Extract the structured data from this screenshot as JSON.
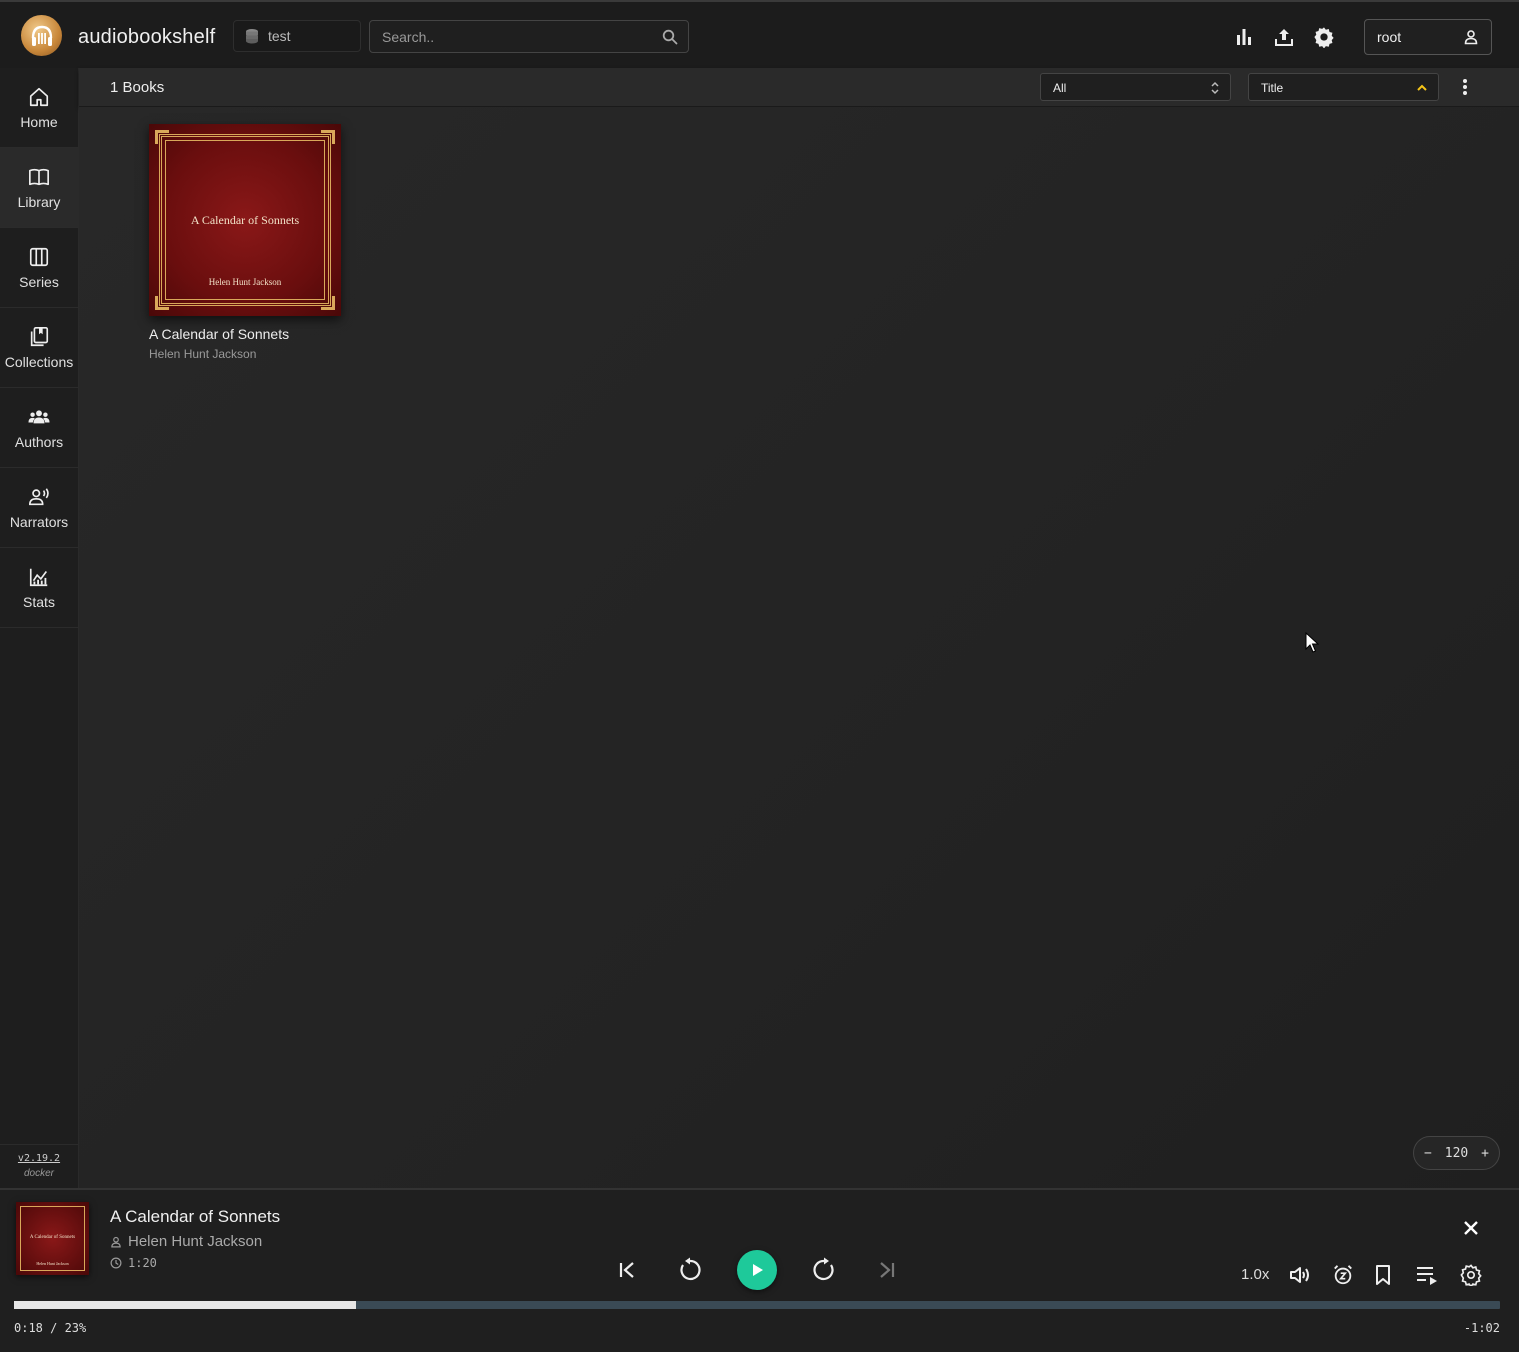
{
  "header": {
    "app_title": "audiobookshelf",
    "library_name": "test",
    "search_placeholder": "Search..",
    "username": "root",
    "icons": [
      "stats-icon",
      "upload-icon",
      "settings-icon",
      "user-icon"
    ]
  },
  "sidebar": {
    "items": [
      {
        "label": "Home",
        "icon": "home-icon"
      },
      {
        "label": "Library",
        "icon": "book-icon",
        "active": true
      },
      {
        "label": "Series",
        "icon": "columns-icon"
      },
      {
        "label": "Collections",
        "icon": "collections-icon"
      },
      {
        "label": "Authors",
        "icon": "people-icon"
      },
      {
        "label": "Narrators",
        "icon": "narrator-icon"
      },
      {
        "label": "Stats",
        "icon": "chart-icon"
      }
    ],
    "version": "v2.19.2",
    "build": "docker"
  },
  "toolbar": {
    "book_count": "1 Books",
    "filter_value": "All",
    "sort_value": "Title"
  },
  "books": [
    {
      "title": "A Calendar of Sonnets",
      "author": "Helen Hunt Jackson",
      "cover_title": "A Calendar of Sonnets",
      "cover_author": "Helen Hunt Jackson"
    }
  ],
  "zoom": {
    "minus": "−",
    "value": "120",
    "plus": "+"
  },
  "player": {
    "title": "A Calendar of Sonnets",
    "author": "Helen Hunt Jackson",
    "duration": "1:20",
    "speed": "1.0x",
    "progress_percent": 23,
    "time_elapsed": "0:18 / 23%",
    "time_remaining": "-1:02"
  },
  "colors": {
    "accent_green": "#1ec99a",
    "sort_arrow": "#f5c518",
    "cover_red": "#7a1010",
    "cover_gold": "#d9a85a"
  }
}
